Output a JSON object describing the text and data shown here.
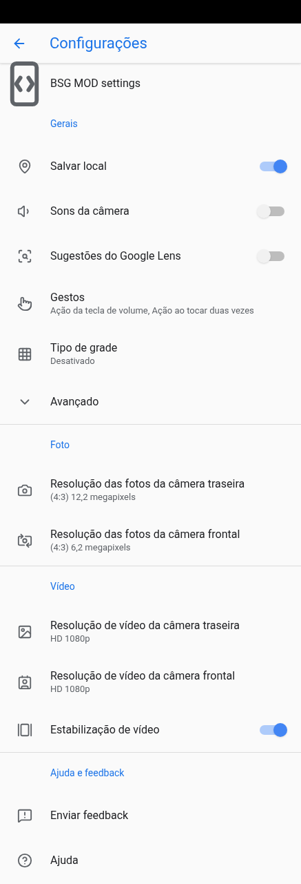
{
  "header": {
    "title": "Configurações"
  },
  "sections": [
    {
      "items": [
        {
          "kind": "plain",
          "title": "BSG MOD settings"
        }
      ]
    },
    {
      "title": "Gerais",
      "items": [
        {
          "kind": "toggle",
          "title": "Salvar local",
          "on": true
        },
        {
          "kind": "toggle",
          "title": "Sons da câmera",
          "on": false
        },
        {
          "kind": "toggle",
          "title": "Sugestões do Google Lens",
          "on": false
        },
        {
          "kind": "plain",
          "title": "Gestos",
          "subtitle": "Ação da tecla de volume, Ação ao tocar duas vezes"
        },
        {
          "kind": "plain",
          "title": "Tipo de grade",
          "subtitle": "Desativado"
        },
        {
          "kind": "plain",
          "title": "Avançado"
        }
      ]
    },
    {
      "title": "Foto",
      "items": [
        {
          "kind": "plain",
          "title": "Resolução das fotos da câmera traseira",
          "subtitle": "(4:3) 12,2 megapixels"
        },
        {
          "kind": "plain",
          "title": "Resolução das fotos da câmera frontal",
          "subtitle": "(4:3) 6,2 megapixels"
        }
      ]
    },
    {
      "title": "Vídeo",
      "items": [
        {
          "kind": "plain",
          "title": "Resolução de vídeo da câmera traseira",
          "subtitle": "HD 1080p"
        },
        {
          "kind": "plain",
          "title": "Resolução de vídeo da câmera frontal",
          "subtitle": "HD 1080p"
        },
        {
          "kind": "toggle",
          "title": "Estabilização de vídeo",
          "on": true
        }
      ]
    },
    {
      "title": "Ajuda e feedback",
      "items": [
        {
          "kind": "plain",
          "title": "Enviar feedback"
        },
        {
          "kind": "plain",
          "title": "Ajuda"
        }
      ]
    }
  ]
}
